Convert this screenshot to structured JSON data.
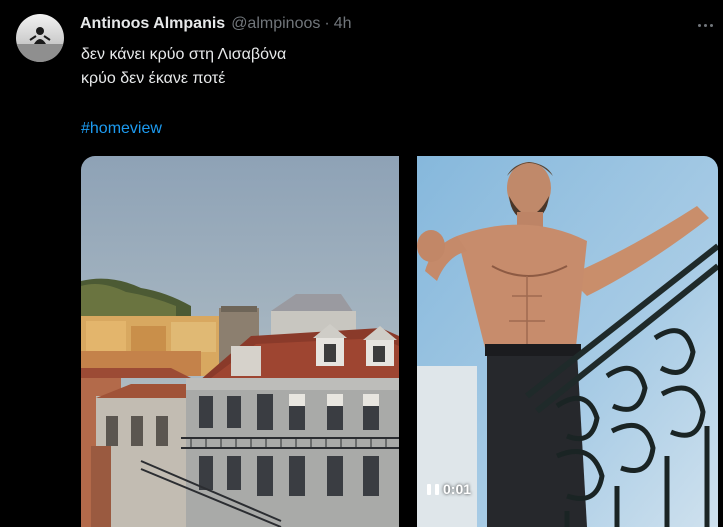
{
  "tweet": {
    "author_name": "Antinoos Almpanis",
    "author_handle": "@almpinoos",
    "separator": "·",
    "timestamp": "4h",
    "text_line1": "δεν κάνει κρύο στη Λισαβόνα",
    "text_line2": "κρύο δεν έκανε ποτέ",
    "hashtag": "#homeview"
  },
  "media": {
    "video_time": "0:01",
    "video_state": "playing"
  },
  "colors": {
    "background": "#000000",
    "primary_text": "#e7e9ea",
    "secondary_text": "#71767b",
    "link": "#1d9bf0"
  },
  "icons": {
    "more": "more-dots-icon",
    "pause": "pause-icon"
  }
}
